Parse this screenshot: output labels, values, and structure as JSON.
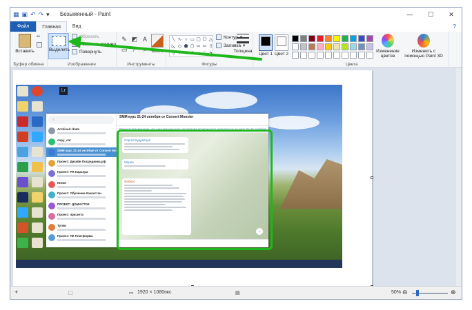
{
  "window": {
    "title": "Безымянный - Paint",
    "controls": {
      "minimize": "—",
      "maximize": "☐",
      "close": "✕"
    }
  },
  "tabs": [
    {
      "label": "Файл"
    },
    {
      "label": "Главная"
    },
    {
      "label": "Вид"
    }
  ],
  "ribbon": {
    "clipboard": {
      "group": "Буфер обмена",
      "paste": "Вставить"
    },
    "image": {
      "group": "Изображение",
      "select": "Выделить",
      "crop": "Обрезать",
      "resize": "Изменить размер",
      "rotate": "Повернуть"
    },
    "tools": {
      "group": "Инструменты",
      "brushes": "Кисти"
    },
    "shapes": {
      "group": "Фигуры",
      "outline": "Контур",
      "fill": "Заливка"
    },
    "size": {
      "label": "Толщина"
    },
    "colors": {
      "group": "Цвета",
      "color1": "Цвет 1",
      "color2": "Цвет 2",
      "edit": "Изменение цветов",
      "paint3d": "Изменить с помощью Paint 3D",
      "color1_value": "#000000",
      "color2_value": "#ffffff",
      "palette": [
        "#000000",
        "#7f7f7f",
        "#880015",
        "#ed1c24",
        "#ff7f27",
        "#fff200",
        "#22b14c",
        "#00a2e8",
        "#3f48cc",
        "#a349a4",
        "#ffffff",
        "#c3c3c3",
        "#b97a57",
        "#ffaec9",
        "#ffc90e",
        "#efe4b0",
        "#b5e61d",
        "#99d9ea",
        "#7092be",
        "#c8bfe7",
        "#ffffff",
        "#ffffff",
        "#ffffff",
        "#ffffff",
        "#ffffff",
        "#ffffff",
        "#ffffff",
        "#ffffff",
        "#ffffff",
        "#ffffff"
      ]
    }
  },
  "telegram": {
    "chat_title": "SMM курс 21-24 октября от Convert Monster",
    "pinned": "Важно! Напоминаем, что сегодня уже есть последняя возможность записаться на курс 21-24 октября ...",
    "chats": [
      {
        "name": "Archived chats",
        "color": "#8e99a6"
      },
      {
        "name": "copy_cat",
        "color": "#2fbf71"
      },
      {
        "name": "SMM курс 21-24 октября от Convert Monster",
        "color": "#3a7bd5"
      },
      {
        "name": "Проект: Дизайн Посредника.рф",
        "color": "#e5a13a"
      },
      {
        "name": "Проект: PR Карьера",
        "color": "#7b6fd6"
      },
      {
        "name": "Юлия",
        "color": "#e05a5a"
      },
      {
        "name": "Проект: Обучение Казахстан",
        "color": "#3fb0c9"
      },
      {
        "name": "ПРОЕКТ: ДОМАСТОК",
        "color": "#9c5ad6"
      },
      {
        "name": "Проект: при.вета",
        "color": "#d66fa0"
      },
      {
        "name": "Тулки",
        "color": "#e07b3a"
      },
      {
        "name": "Проект: ПК Платформа",
        "color": "#5a9bd6"
      }
    ],
    "messages": [
      {
        "author": "Сергей Кудрявцев"
      },
      {
        "author": "Мария"
      },
      {
        "author": "Фабиос"
      }
    ]
  },
  "status": {
    "dimensions": "1920 × 1080пкс",
    "zoom": "50%",
    "zoom_minus": "⊖",
    "zoom_plus": "⊕"
  },
  "accent": {
    "highlight": "#1fb81c",
    "file_tab": "#1e5fb4"
  }
}
